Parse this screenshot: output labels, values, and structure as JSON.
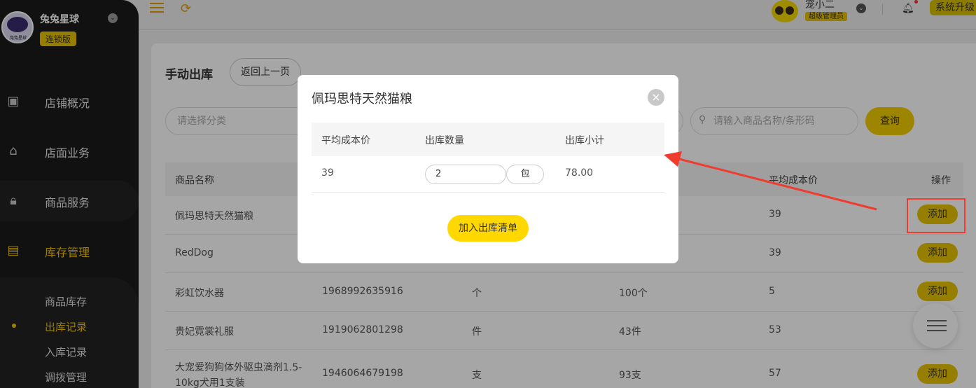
{
  "sidebar": {
    "brand_name": "兔兔星球",
    "brand_badge": "连锁版",
    "logo_text": "兔兔星球",
    "items": [
      {
        "label": "店铺概况",
        "icon": "dashboard-icon"
      },
      {
        "label": "店面业务",
        "icon": "home-icon"
      },
      {
        "label": "商品服务",
        "icon": "bag-icon"
      },
      {
        "label": "库存管理",
        "icon": "inventory-icon"
      }
    ],
    "subitems": [
      {
        "label": "商品库存"
      },
      {
        "label": "出库记录"
      },
      {
        "label": "入库记录"
      },
      {
        "label": "调拨管理"
      }
    ]
  },
  "topbar": {
    "user_name": "宠小二",
    "user_role": "超级管理员",
    "upgrade_label": "系统升级"
  },
  "page": {
    "title": "手动出库",
    "back_label": "返回上一页",
    "category_placeholder": "请选择分类",
    "search_placeholder": "请输入商品名称/条形码",
    "query_label": "查询"
  },
  "table": {
    "headers": {
      "name": "商品名称",
      "avg_cost": "平均成本价",
      "action": "操作"
    },
    "rows": [
      {
        "name": "佩玛思特天然猫粮",
        "barcode": "",
        "unit": "",
        "stock": "",
        "avg_cost": "39",
        "action": "添加"
      },
      {
        "name": "RedDog",
        "barcode": "",
        "unit": "",
        "stock": "",
        "avg_cost": "39",
        "action": "添加"
      },
      {
        "name": "彩虹饮水器",
        "barcode": "1968992635916",
        "unit": "个",
        "stock": "100个",
        "avg_cost": "5",
        "action": "添加"
      },
      {
        "name": "贵妃霓裳礼服",
        "barcode": "1919062801298",
        "unit": "件",
        "stock": "43件",
        "avg_cost": "53",
        "action": ""
      },
      {
        "name": "大宠爱狗狗体外驱虫滴剂1.5-",
        "name2": "10kg犬用1支装",
        "barcode": "1946064679198",
        "unit": "支",
        "stock": "93支",
        "avg_cost": "57",
        "action": "添加"
      }
    ]
  },
  "modal": {
    "title": "佩玛思特天然猫粮",
    "headers": {
      "avg_cost": "平均成本价",
      "qty": "出库数量",
      "subtotal": "出库小计"
    },
    "row": {
      "avg_cost": "39",
      "qty": "2",
      "unit": "包",
      "subtotal": "78.00"
    },
    "confirm_label": "加入出库清单"
  },
  "colors": {
    "accent": "#f2cc00",
    "annotation": "#f03c2e",
    "sidebar_bg": "#1b1b1b"
  }
}
